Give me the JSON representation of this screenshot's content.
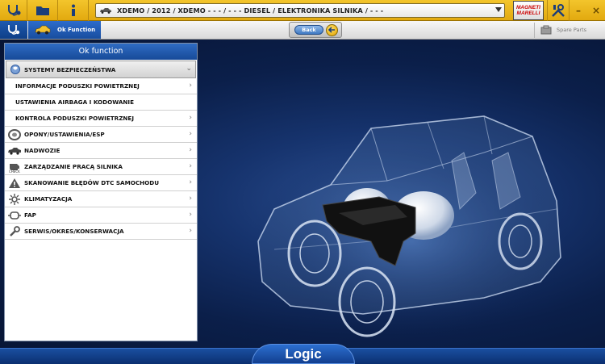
{
  "toolbar": {
    "vehicle_path": "XDEMO / 2012 / XDEMO - - - / - - - DIESEL / ELEKTRONIKA SILNIKA / - - -",
    "brand_logo_lines": [
      "MAGNETI",
      "MARELLI"
    ],
    "minimize_label": "–",
    "close_label": "×"
  },
  "subbar": {
    "active_tab": "Ok Function",
    "back_label": "Back",
    "spare_parts_label": "Spare Parts"
  },
  "panel": {
    "title": "Ok function",
    "category": "SYSTEMY BEZPIECZEŃSTWA",
    "sub_items": [
      {
        "label": "INFORMACJE PODUSZKI POWIETRZNEJ",
        "has_arrow": true
      },
      {
        "label": "USTAWIENIA AIRBAGA I KODOWANIE",
        "has_arrow": false
      },
      {
        "label": "KONTROLA PODUSZKI POWIETRZNEJ",
        "has_arrow": true
      }
    ],
    "items": [
      {
        "label": "OPONY/USTAWIENIA/ESP",
        "icon": "tire-icon"
      },
      {
        "label": "NADWOZIE",
        "icon": "car-body-icon"
      },
      {
        "label": "ZARZĄDZANIE PRACĄ SILNIKA",
        "icon": "check-engine-icon"
      },
      {
        "label": "SKANOWANIE BŁĘDÓW DTC SAMOCHODU",
        "icon": "warning-icon"
      },
      {
        "label": "KLIMATYZACJA",
        "icon": "climate-icon"
      },
      {
        "label": "FAP",
        "icon": "dpf-icon"
      },
      {
        "label": "SERWIS/OKRES/KONSERWACJA",
        "icon": "wrench-icon"
      }
    ],
    "chevron": "›"
  },
  "footer": {
    "brand": "Logic"
  },
  "colors": {
    "toolbar_yellow": "#e9b41a",
    "header_blue": "#1d5ab0",
    "background_blue": "#0b1f4a"
  }
}
